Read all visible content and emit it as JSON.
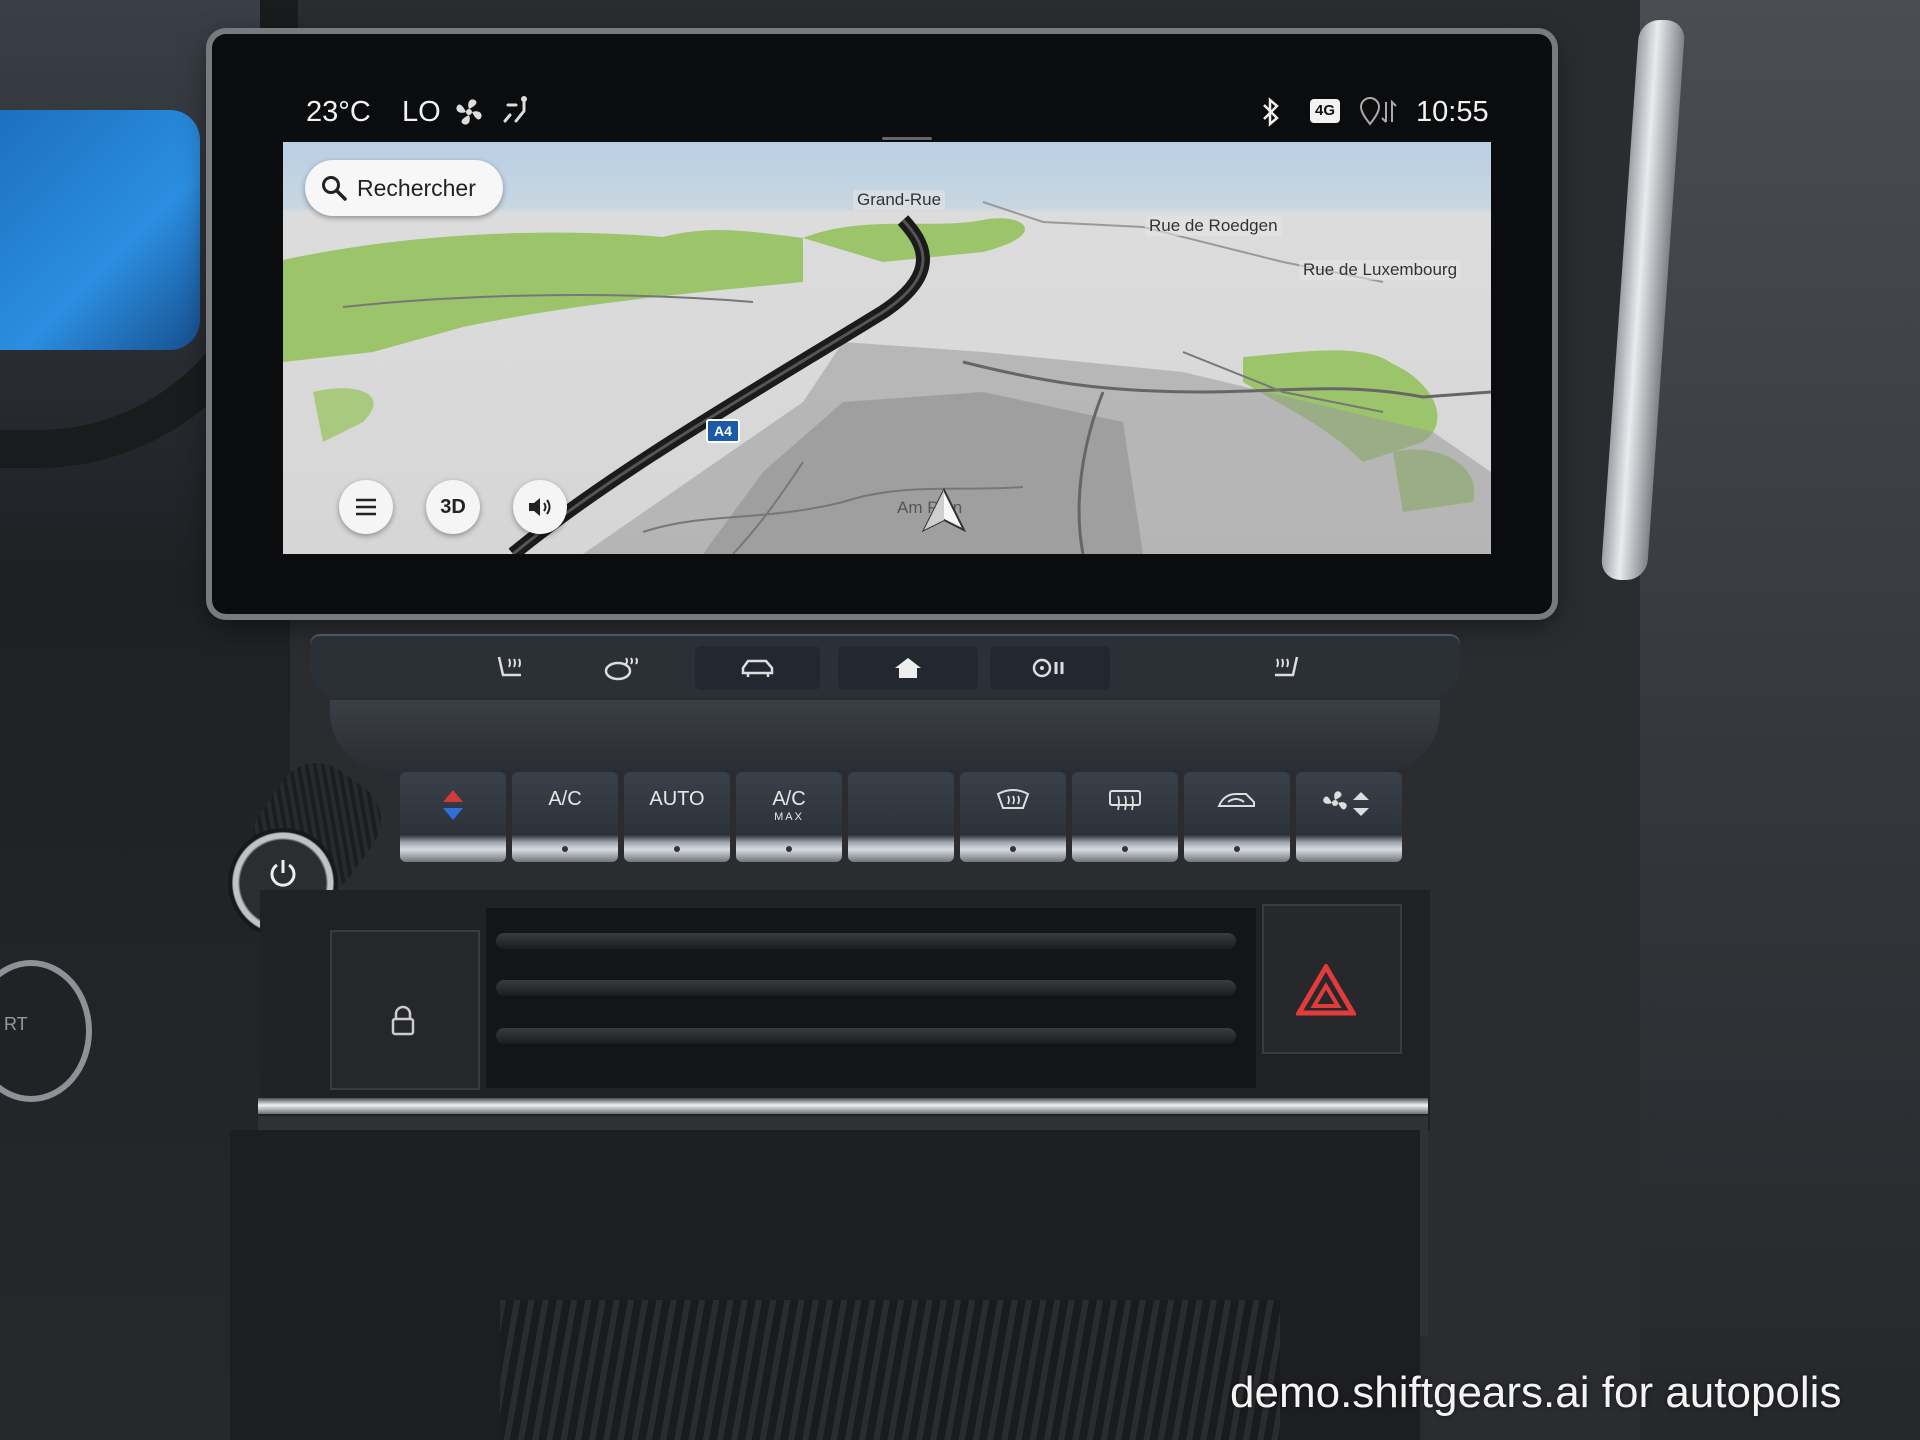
{
  "status_bar": {
    "temperature": "23°C",
    "ac_level": "LO",
    "fan_icon": "fan-icon",
    "airflow_icon": "airflow-direction-icon",
    "bluetooth_icon": "bluetooth-icon",
    "network": "4G",
    "location_icon": "location-sync-icon",
    "clock": "10:55"
  },
  "map": {
    "search_label": "Rechercher",
    "road_labels": {
      "grand_rue": "Grand-Rue",
      "roedgen": "Rue de Roedgen",
      "luxembourg": "Rue de Luxembourg",
      "current": "Am Pa n"
    },
    "highway_shield": "A4",
    "buttons": {
      "menu_icon": "menu-icon",
      "view_3d": "3D",
      "volume_icon": "volume-icon"
    },
    "colors": {
      "sky": "#b9cfe4",
      "land": "#d6d6d6",
      "green": "#9cc46a",
      "road": "#1b1b1b"
    }
  },
  "shortcut_bar": {
    "seat_heat_icon": "seat-heat-left-icon",
    "wheel_heat_icon": "steering-heat-icon",
    "car_icon": "car-icon",
    "home_icon": "home-icon",
    "climate_icon": "climate-settings-icon",
    "seat_heat_right_icon": "seat-heat-right-icon"
  },
  "climate_keys": {
    "temp_icon": "temperature-up-down-icon",
    "ac": "A/C",
    "auto": "AUTO",
    "ac_max": "A/C",
    "ac_max_sub": "MAX",
    "front_defrost_icon": "front-defrost-icon",
    "rear_defrost_icon": "rear-defrost-icon",
    "recirc_icon": "air-recirculation-icon",
    "fan_icon": "fan-speed-icon"
  },
  "console": {
    "power_icon": "power-icon",
    "lock_icon": "lock-icon",
    "hazard_icon": "hazard-icon",
    "start_text": "RT"
  },
  "watermark": "demo.shiftgears.ai for autopolis"
}
